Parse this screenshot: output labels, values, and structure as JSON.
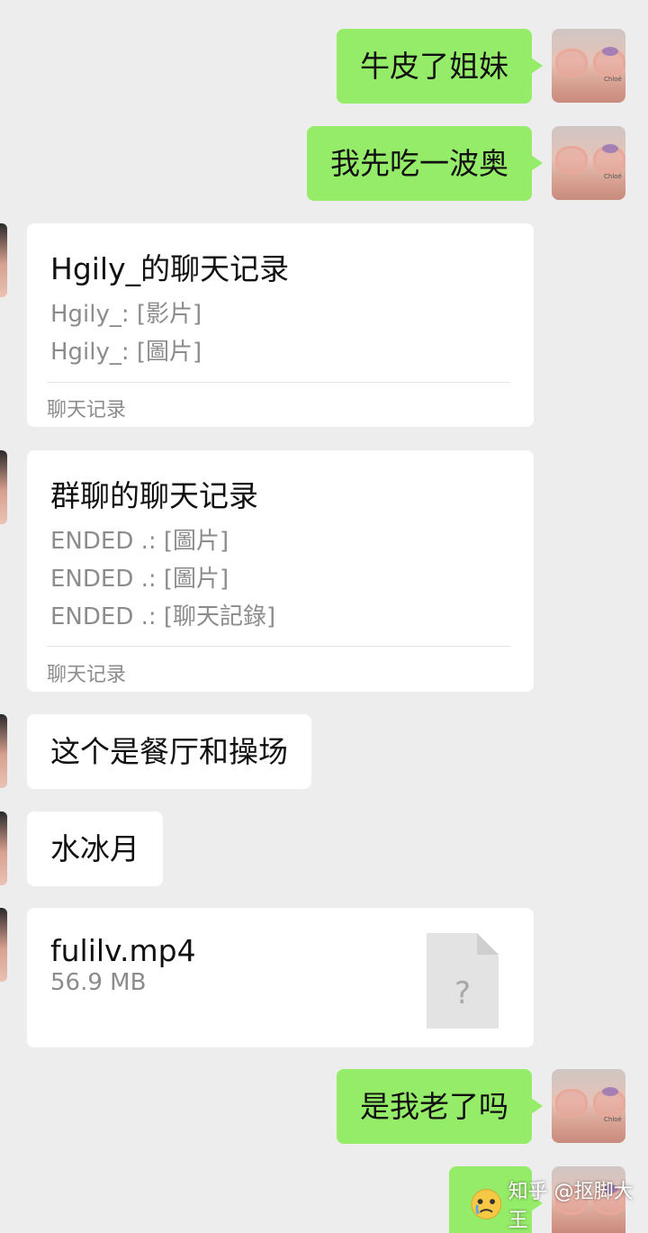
{
  "messages": {
    "m1": "牛皮了姐妹",
    "m2": "我先吃一波奥",
    "m3": "这个是餐厅和操场",
    "m4": "水冰月",
    "m5": "是我老了吗"
  },
  "card1": {
    "title": "Hgily_的聊天记录",
    "lines": [
      "Hgily_: [影片]",
      "Hgily_: [圖片]"
    ],
    "footer": "聊天记录"
  },
  "card2": {
    "title": "群聊的聊天记录",
    "lines": [
      "ENDED .: [圖片]",
      "ENDED .: [圖片]",
      "ENDED .: [聊天記錄]"
    ],
    "footer": "聊天记录"
  },
  "file": {
    "name": "fulilv.mp4",
    "size": "56.9 MB",
    "icon_symbol": "?"
  },
  "avatar_label": "Chloé",
  "watermark": "知乎 @抠脚大王",
  "colors": {
    "bg": "#ededed",
    "sent_bubble": "#95ec69",
    "received_bubble": "#ffffff",
    "muted_text": "#8c8c8c"
  }
}
